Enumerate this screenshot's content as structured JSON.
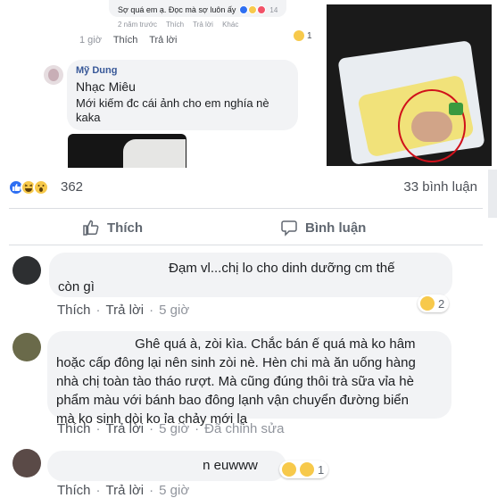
{
  "top_reply": {
    "name": "",
    "text": "Sợ quá em ạ. Đọc mà sợ luôn ấy",
    "reaction_count": "14",
    "sub_meta": [
      "2 năm trước",
      "Thích",
      "Trả lời",
      "Khác"
    ]
  },
  "comment_meta_top": {
    "age": "1 giờ",
    "like": "Thích",
    "reply": "Trả lời",
    "reaction_count": "1"
  },
  "reply_mydung": {
    "author": "Mỹ Dung",
    "line1": "Nhạc Miêu",
    "line2": "Mới kiếm đc cái ảnh cho em nghía nè kaka"
  },
  "post_stats": {
    "reaction_count": "362",
    "comment_count": "33 bình luận"
  },
  "actions": {
    "like": "Thích",
    "comment": "Bình luận"
  },
  "comments": [
    {
      "text_line1": "Đạm vl...chị lo cho dinh dưỡng cm thế",
      "text_line2": "còn gì",
      "like": "Thích",
      "reply": "Trả lời",
      "age": "5 giờ",
      "edited": "",
      "reaction_count": "2"
    },
    {
      "text_line1": "Ghê quá à, zòi kìa. Chắc bán ế quá mà ko hâm",
      "text_line2": "hoặc cấp đông lại nên sinh zòi nè. Hèn chi mà ăn uống hàng",
      "text_line3": "nhà chị toàn tào tháo rượt. Mà cũng đúng thôi trà sữa vỉa hè",
      "text_line4": "phẩm màu với bánh bao đông lạnh vận chuyển đường biển",
      "text_line5": "mà ko sinh dòi ko ỉa chảy mới lạ",
      "like": "Thích",
      "reply": "Trả lời",
      "age": "5 giờ",
      "edited": "Đã chỉnh sửa"
    },
    {
      "text_line1": "n euwww",
      "like": "Thích",
      "reply": "Trả lời",
      "age": "5 giờ",
      "reaction_count": "1"
    }
  ],
  "colors": {
    "link_blue": "#385898",
    "like_blue": "#2e6ff2",
    "meta_gray": "#90949c",
    "bubble_bg": "#f2f3f5",
    "emoji_yellow": "#f7c94b"
  }
}
